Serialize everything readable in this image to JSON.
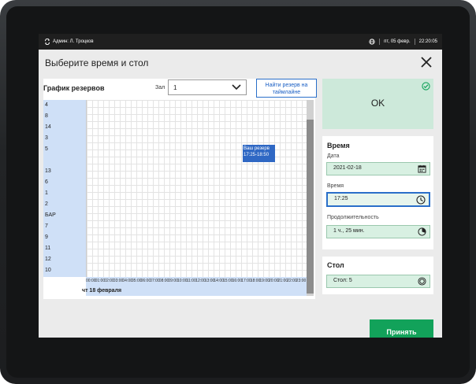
{
  "status_bar": {
    "user": "Админ: Л. Троцков",
    "date": "пт, 05 февр.",
    "time": "22:20:05",
    "icons": [
      "sync-icon",
      "globe-icon"
    ]
  },
  "dialog": {
    "title": "Выберите время и стол"
  },
  "schedule": {
    "title": "График резервов",
    "hall_label": "Зал",
    "hall_value": "1",
    "find_button": "Найти резерв на таймлайне",
    "rows": [
      "4",
      "8",
      "14",
      "3",
      "5",
      "",
      "13",
      "6",
      "1",
      "2",
      "БАР",
      "7",
      "9",
      "11",
      "12",
      "10"
    ],
    "time_ticks": [
      "00:00",
      "01:00",
      "02:00",
      "03:00",
      "04:00",
      "05:00",
      "06:00",
      "07:00",
      "08:00",
      "09:00",
      "10:00",
      "11:00",
      "12:00",
      "13:00",
      "14:00",
      "15:00",
      "16:00",
      "17:00",
      "18:00",
      "19:00",
      "20:00",
      "21:00",
      "22:00",
      "23:00"
    ],
    "date_label": "чт 18 февраля",
    "reservation_label": "Ваш резерв 17:25-18:50"
  },
  "ok_panel": {
    "label": "OK"
  },
  "time_card": {
    "title": "Время",
    "date_label": "Дата",
    "date_value": "2021-02-18",
    "time_label": "Время",
    "time_value": "17:25",
    "duration_label": "Продолжительность",
    "duration_value": "1 ч., 25 мин."
  },
  "table_card": {
    "title": "Стол",
    "value": "Стол: 5"
  },
  "actions": {
    "accept": "Принять"
  },
  "colors": {
    "accent": "#2a6fc9",
    "success": "#12a25a",
    "field_bg": "#d8f0e2"
  }
}
